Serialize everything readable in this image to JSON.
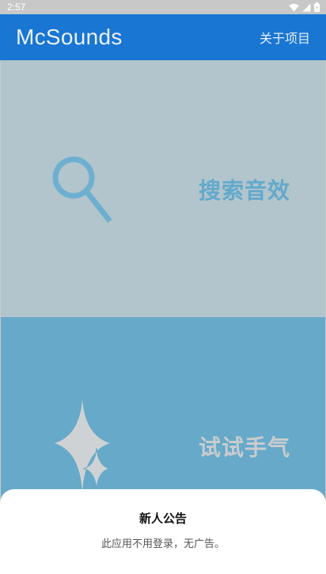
{
  "status_bar": {
    "time": "2:57",
    "icons": [
      "wifi-icon",
      "cellular-signal-icon",
      "battery-icon"
    ]
  },
  "app_bar": {
    "title": "McSounds",
    "action_label": "关于项目",
    "color": "#1976d2"
  },
  "panels": [
    {
      "label": "搜索音效",
      "icon": "search-icon",
      "color": "#b2c5cc"
    },
    {
      "label": "试试手气",
      "icon": "sparkle-icon",
      "color": "#67a9c8"
    }
  ],
  "bottom_sheet": {
    "title": "新人公告",
    "body": "此应用不用登录，无广告。"
  }
}
